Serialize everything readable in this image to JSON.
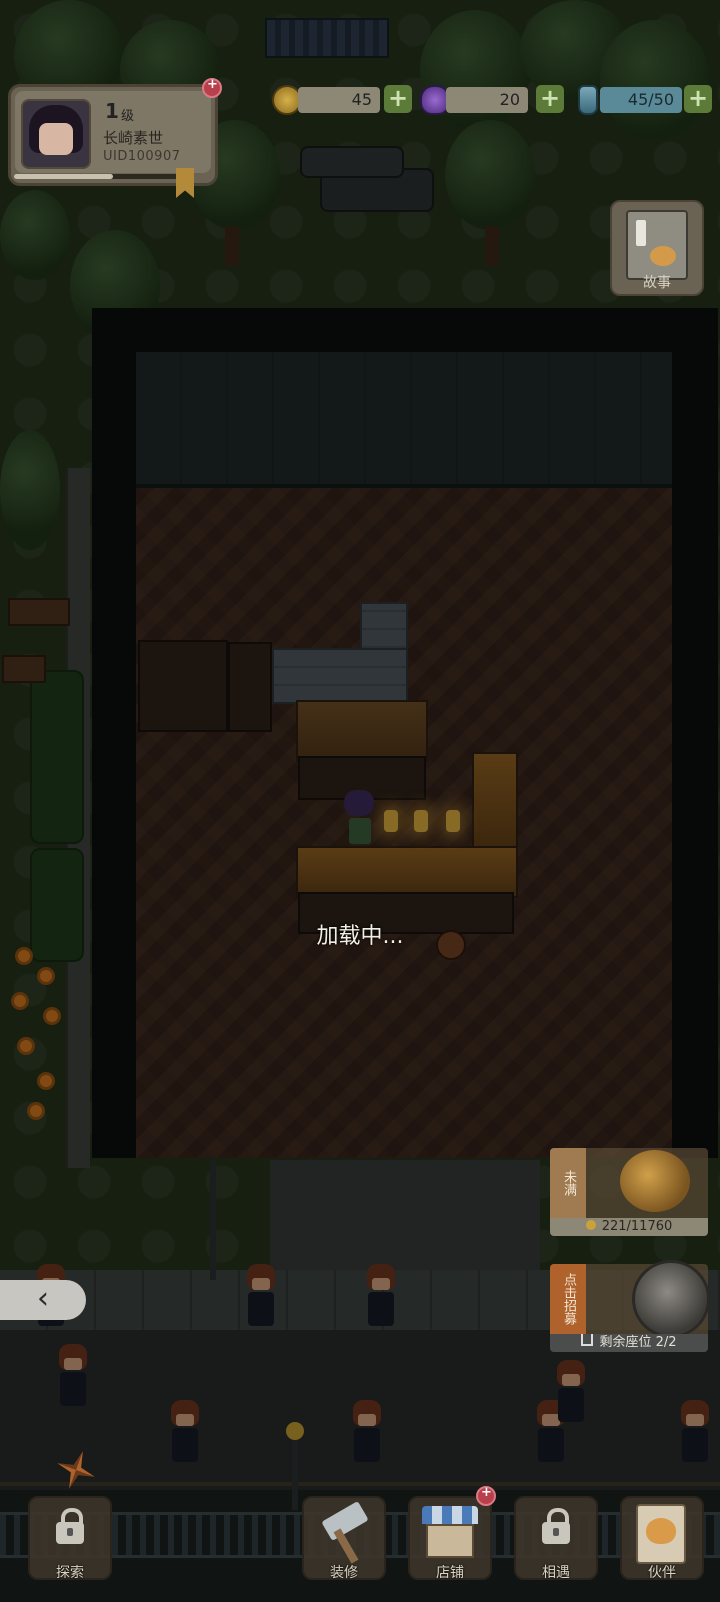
{
  "profile": {
    "level": "1",
    "level_suffix": "级",
    "name": "长崎素世",
    "uid": "UID100907",
    "xp_fraction": 0.55
  },
  "resources": [
    {
      "id": "coins",
      "icon": "coin-icon",
      "value": "45",
      "color": "#c9a23e"
    },
    {
      "id": "gems",
      "icon": "purple-gem-icon",
      "value": "20",
      "color": "#7a4aa8"
    },
    {
      "id": "stamina",
      "icon": "bottle-icon",
      "value": "45/50",
      "color": "#5a9ab0"
    }
  ],
  "story": {
    "label": "故事"
  },
  "loading": {
    "text": "加载中..."
  },
  "side": {
    "savings": {
      "tag": "未满",
      "value": "221/11760"
    },
    "recruit": {
      "tag": "点击招募",
      "value": "剩余座位 2/2"
    }
  },
  "collapse": {
    "glyph": "‹"
  },
  "nav": [
    {
      "id": "explore",
      "label": "探索",
      "icon": "lock-icon",
      "locked": true
    },
    {
      "id": "decorate",
      "label": "装修",
      "icon": "hammer-icon",
      "locked": false
    },
    {
      "id": "shop",
      "label": "店铺",
      "icon": "shop-icon",
      "locked": false
    },
    {
      "id": "encounter",
      "label": "相遇",
      "icon": "lock-icon",
      "locked": true
    },
    {
      "id": "partner",
      "label": "伙伴",
      "icon": "cat-card-icon",
      "locked": false
    }
  ]
}
